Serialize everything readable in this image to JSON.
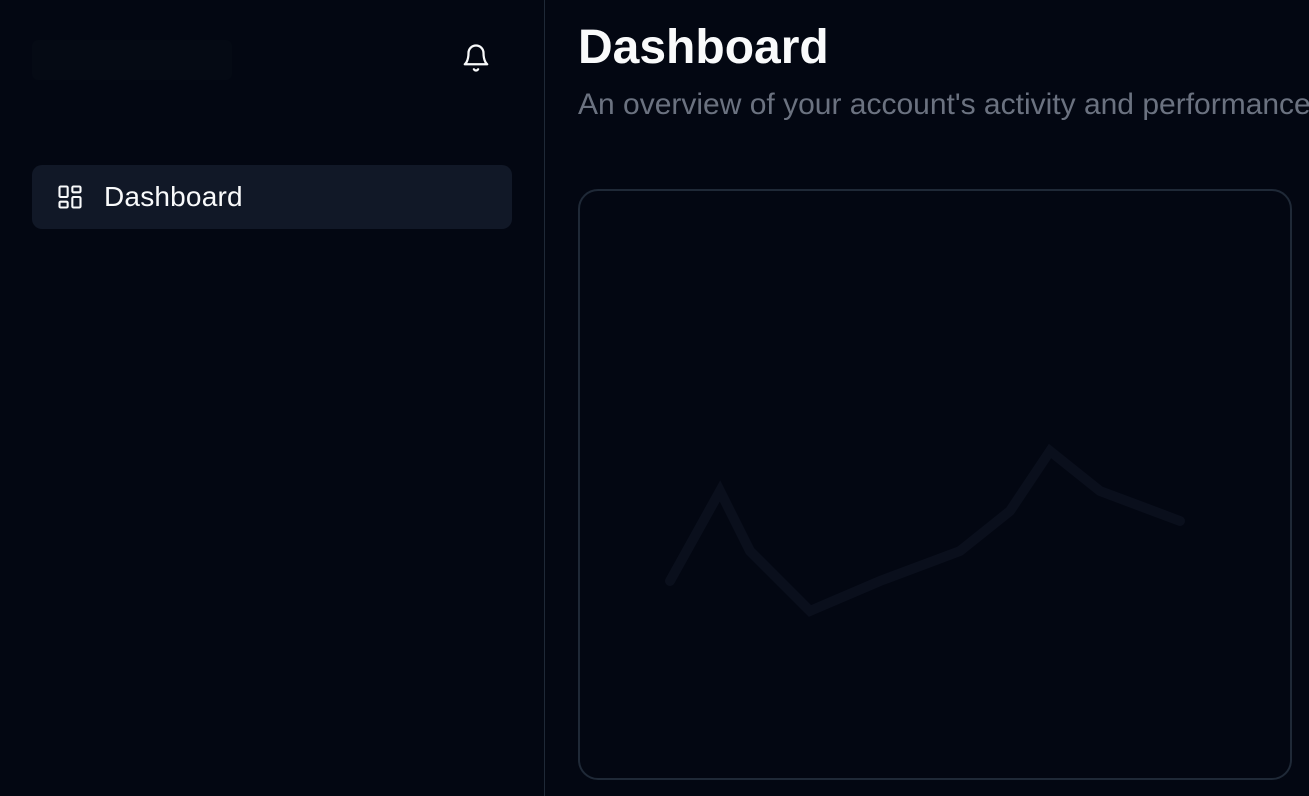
{
  "colors": {
    "background": "#030712",
    "nav_active": "#111827",
    "border": "#1f2937",
    "text_primary": "#f9fafb",
    "text_muted": "#6b7280"
  },
  "header": {
    "notification_icon": "bell-icon"
  },
  "sidebar": {
    "items": [
      {
        "label": "Dashboard",
        "icon": "dashboard-grid-icon",
        "active": true
      }
    ]
  },
  "main": {
    "title": "Dashboard",
    "subtitle": "An overview of your account's activity and performance"
  }
}
